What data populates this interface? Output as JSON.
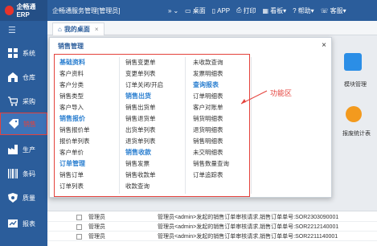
{
  "app": {
    "logo_text": "企畅通ERP",
    "window_title": "企畅通服务管理[管理员]"
  },
  "topbar": {
    "items": [
      {
        "icon": "double-chevron-icon",
        "label": ""
      },
      {
        "icon": "desktop-icon",
        "label": "桌面"
      },
      {
        "icon": "app-icon",
        "label": "APP"
      },
      {
        "icon": "printer-icon",
        "label": "打印"
      },
      {
        "icon": "dashboard-icon",
        "label": "看板"
      },
      {
        "icon": "help-icon",
        "label": "帮助"
      },
      {
        "icon": "service-icon",
        "label": "客服"
      }
    ]
  },
  "tabs": [
    {
      "label": "我的桌面",
      "close": "×"
    }
  ],
  "sidebar": {
    "items": [
      {
        "label": "系统",
        "icon": "grid-icon"
      },
      {
        "label": "仓库",
        "icon": "warehouse-icon"
      },
      {
        "label": "采购",
        "icon": "cart-icon"
      },
      {
        "label": "销售",
        "icon": "tag-icon"
      },
      {
        "label": "生产",
        "icon": "factory-icon"
      },
      {
        "label": "条码",
        "icon": "barcode-icon"
      },
      {
        "label": "质量",
        "icon": "shield-icon"
      },
      {
        "label": "报表",
        "icon": "report-icon"
      }
    ]
  },
  "panel": {
    "title": "销售管理",
    "close": "×",
    "callout": "功能区",
    "columns": [
      {
        "groups": [
          {
            "heading": "基础资料",
            "items": [
              "客户资料",
              "客户分类",
              "销售类型",
              "客户导入"
            ]
          },
          {
            "heading": "销售报价",
            "items": [
              "销售报价单",
              "报价单列表",
              "客户单价"
            ]
          },
          {
            "heading": "订单管理",
            "items": [
              "销售订单",
              "订单列表"
            ]
          }
        ]
      },
      {
        "groups": [
          {
            "heading": "",
            "items": [
              "销售变更单",
              "变更单列表",
              "订单关闭/开启"
            ]
          },
          {
            "heading": "销售出货",
            "items": [
              "销售出货单",
              "销售退货单",
              "出货单列表",
              "退货单列表"
            ]
          },
          {
            "heading": "销售收款",
            "items": [
              "销售发票",
              "销售收款单",
              "收款查询"
            ]
          }
        ]
      },
      {
        "groups": [
          {
            "heading": "",
            "items": [
              "未收款查询",
              "发票明细表"
            ]
          },
          {
            "heading": "查询报表",
            "items": [
              "订单明细表",
              "客户对账单",
              "销货明细表",
              "退货明细表",
              "销售明细表",
              "未交明细表",
              "销售数量查询",
              "订单追踪表"
            ]
          }
        ]
      }
    ]
  },
  "right_tiles": [
    {
      "label": "模块管理",
      "icon": "module-icon",
      "color": "#2b8ee6"
    },
    {
      "label": "报废统计表",
      "icon": "report-circle-icon",
      "color": "#f39a1e"
    }
  ],
  "messages": [
    {
      "who": "管理员",
      "text": "管理员<admin>发起的销售订单审核请求,销售订单单号:SOR2303090001"
    },
    {
      "who": "管理员",
      "text": "管理员<admin>发起的销售订单审核请求,销售订单单号:SOR2212140001"
    },
    {
      "who": "管理员",
      "text": "管理员<admin>发起的销售订单审核请求,销售订单单号:SOR2211140001"
    }
  ],
  "colors": {
    "primary": "#2b5d9b",
    "accent_red": "#e4413b",
    "link_blue": "#2b7fd0"
  }
}
